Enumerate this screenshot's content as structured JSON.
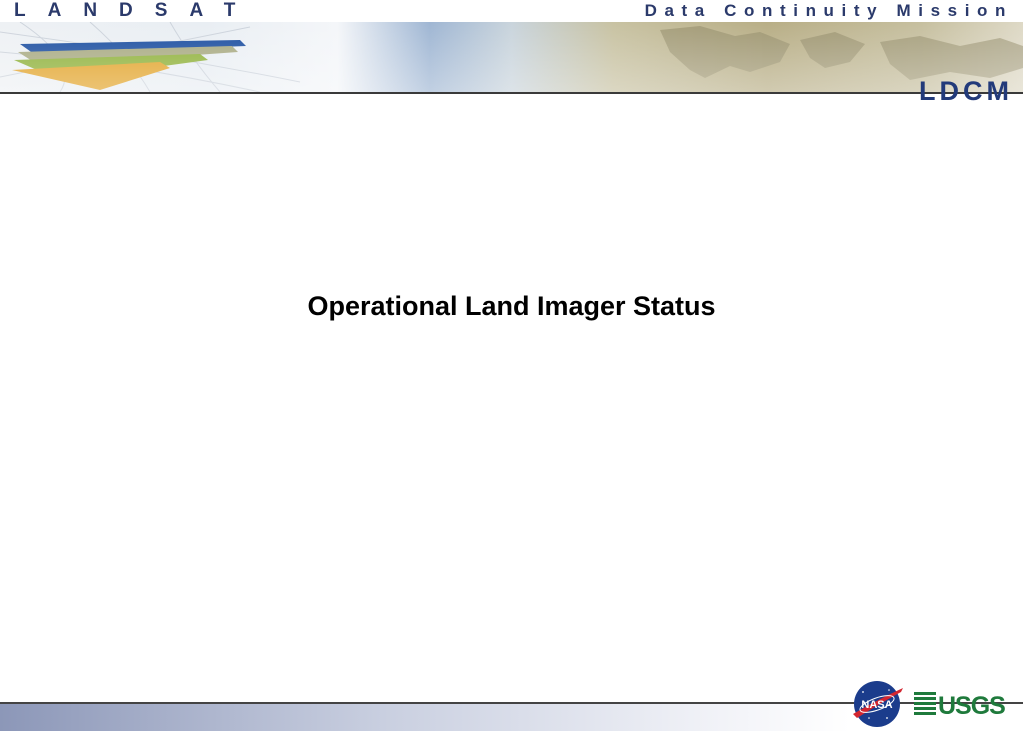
{
  "header": {
    "left_title": "LANDSAT",
    "right_title": "Data Continuity Mission",
    "badge": "LDCM"
  },
  "slide": {
    "title": "Operational Land Imager Status"
  },
  "footer": {
    "logos": [
      "nasa-logo",
      "usgs-logo"
    ],
    "nasa_text": "NASA",
    "usgs_text": "USGS"
  },
  "colors": {
    "header_text": "#2b3a6b",
    "badge_text": "#223a7a",
    "title_text": "#000000",
    "usgs_green": "#1f7a3c",
    "nasa_blue": "#1b3c8c",
    "nasa_red": "#d22630"
  }
}
